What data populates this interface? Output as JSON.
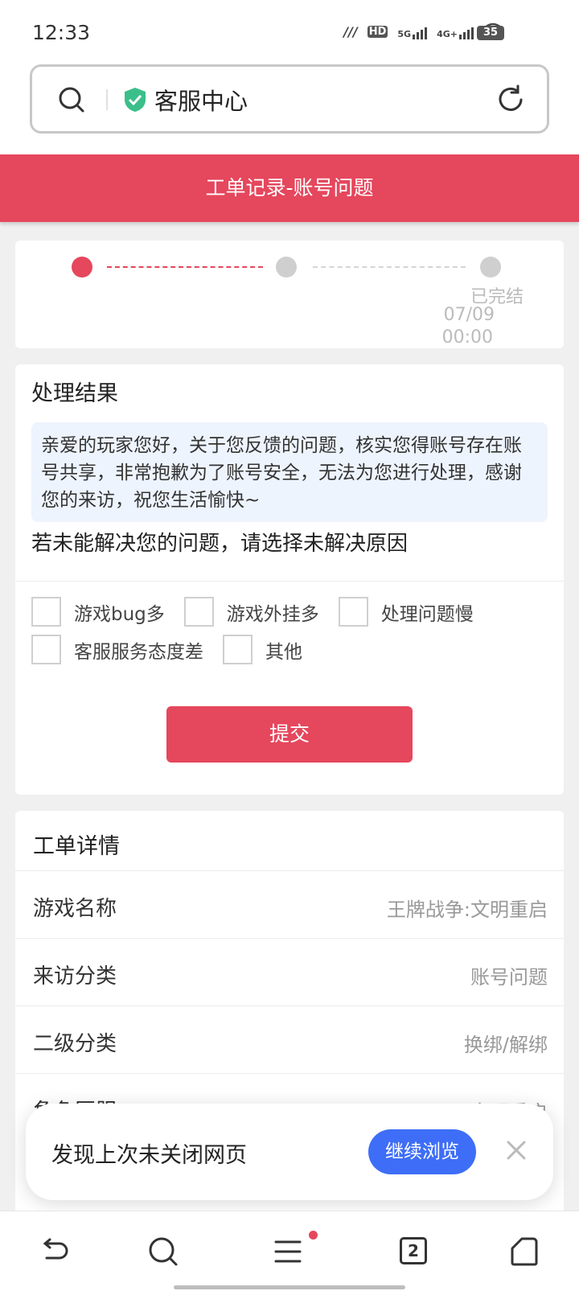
{
  "status_bar": {
    "time": "12:33",
    "network_5g": "5G",
    "network_4g": "4G+",
    "hd": "HD",
    "battery": "35"
  },
  "url_bar": {
    "title": "客服中心"
  },
  "header": {
    "title": "工单记录-账号问题"
  },
  "progress": {
    "status": "已完结",
    "date": "07/09",
    "time": "00:00"
  },
  "result": {
    "title": "处理结果",
    "reply": "亲爱的玩家您好，关于您反馈的问题，核实您得账号存在账号共享，非常抱歉为了账号安全，无法为您进行处理，感谢您的来访，祝您生活愉快~",
    "unsolved_prompt": "若未能解决您的问题，请选择未解决原因",
    "reasons": [
      "游戏bug多",
      "游戏外挂多",
      "处理问题慢",
      "客服服务态度差",
      "其他"
    ],
    "submit_label": "提交"
  },
  "details": {
    "title": "工单详情",
    "rows": [
      {
        "key": "游戏名称",
        "value": "王牌战争:文明重启"
      },
      {
        "key": "来访分类",
        "value": "账号问题"
      },
      {
        "key": "二级分类",
        "value": "换绑/解绑"
      },
      {
        "key": "角色区服",
        "value": "文明重启"
      }
    ]
  },
  "toast": {
    "text": "发现上次未关闭网页",
    "button": "继续浏览"
  },
  "bottom_nav": {
    "tabs_count": "2",
    "icons": [
      "back-icon",
      "search-icon",
      "menu-icon",
      "tabs-icon",
      "home-icon"
    ]
  },
  "colors": {
    "accent": "#e5475d",
    "toast_button": "#3e6ef7",
    "reply_bg": "#eef4fe"
  }
}
